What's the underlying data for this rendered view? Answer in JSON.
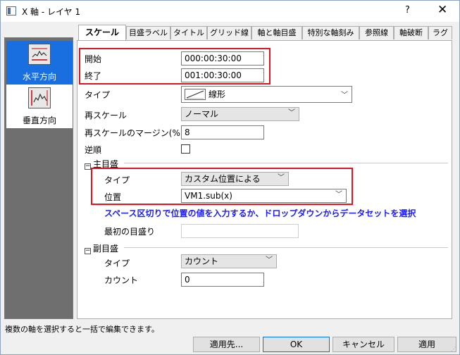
{
  "window": {
    "title": "X 軸 - レイヤ 1",
    "help_label": "?",
    "close_label": "✕"
  },
  "sidebar": {
    "items": [
      {
        "label": "水平方向",
        "icon": "horizontal-axis-icon",
        "selected": true
      },
      {
        "label": "垂直方向",
        "icon": "vertical-axis-icon",
        "selected": false
      }
    ]
  },
  "tabs": [
    {
      "label": "スケール",
      "active": true
    },
    {
      "label": "目盛ラベル"
    },
    {
      "label": "タイトル"
    },
    {
      "label": "グリッド線"
    },
    {
      "label": "軸と軸目盛"
    },
    {
      "label": "特別な軸刻み"
    },
    {
      "label": "参照線"
    },
    {
      "label": "軸破断"
    },
    {
      "label": "ラグ"
    }
  ],
  "scale": {
    "from_label": "開始",
    "from_value": "000:00:30:00",
    "to_label": "終了",
    "to_value": "001:00:30:00",
    "type_label": "タイプ",
    "type_value": "線形",
    "rescale_label": "再スケール",
    "rescale_value": "ノーマル",
    "rescale_margin_label": "再スケールのマージン(%)",
    "rescale_margin_value": "8",
    "reverse_label": "逆順",
    "reverse_checked": false
  },
  "major_ticks": {
    "header": "主目盛",
    "type_label": "タイプ",
    "type_value": "カスタム位置による",
    "position_label": "位置",
    "position_value": "VM1.sub(x)",
    "hint": "スペース区切りで位置の値を入力するか、ドロップダウンからデータセットを選択",
    "first_tick_label": "最初の目盛り",
    "first_tick_value": ""
  },
  "minor_ticks": {
    "header": "副目盛",
    "type_label": "タイプ",
    "type_value": "カウント",
    "count_label": "カウント",
    "count_value": "0"
  },
  "status_text": "複数の軸を選択すると一括で編集できます。",
  "buttons": {
    "apply_to": "適用先...",
    "ok": "OK",
    "cancel": "キャンセル",
    "apply": "適用"
  },
  "colors": {
    "highlight_box": "#e0141e",
    "hint_text": "#1a1aff",
    "selected_item": "#1a6fe0"
  }
}
